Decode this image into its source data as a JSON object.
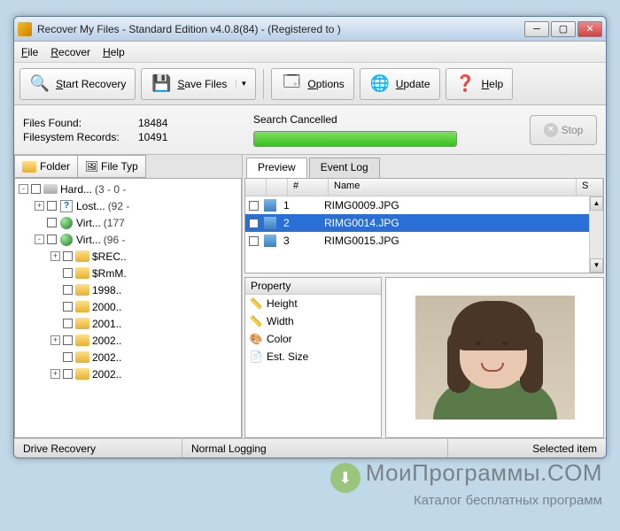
{
  "title": "Recover My Files - Standard Edition v4.0.8(84)  -  (Registered to )",
  "menu": {
    "file": "File",
    "recover": "Recover",
    "help": "Help"
  },
  "toolbar": {
    "start": "Start Recovery",
    "save": "Save Files",
    "options": "Options",
    "update": "Update",
    "help": "Help"
  },
  "status": {
    "found_lbl": "Files Found:",
    "found_val": "18484",
    "records_lbl": "Filesystem Records:",
    "records_val": "10491",
    "search_state": "Search Cancelled",
    "stop": "Stop"
  },
  "left_tabs": {
    "folder": "Folder",
    "filetype": "File Typ"
  },
  "tree": [
    {
      "indent": 0,
      "exp": "-",
      "icon": "drive",
      "label": "Hard...",
      "suffix": "(3 - 0 -"
    },
    {
      "indent": 1,
      "exp": "+",
      "icon": "q",
      "label": "Lost...",
      "suffix": "(92 -"
    },
    {
      "indent": 1,
      "exp": "",
      "icon": "globe",
      "label": "Virt...",
      "suffix": "(177"
    },
    {
      "indent": 1,
      "exp": "-",
      "icon": "globe",
      "label": "Virt...",
      "suffix": "(96 -"
    },
    {
      "indent": 2,
      "exp": "+",
      "icon": "folder",
      "label": "$REC..",
      "suffix": ""
    },
    {
      "indent": 2,
      "exp": "",
      "icon": "folder",
      "label": "$RmM.",
      "suffix": ""
    },
    {
      "indent": 2,
      "exp": "",
      "icon": "folder",
      "label": "1998..",
      "suffix": ""
    },
    {
      "indent": 2,
      "exp": "",
      "icon": "folder",
      "label": "2000..",
      "suffix": ""
    },
    {
      "indent": 2,
      "exp": "",
      "icon": "folder",
      "label": "2001..",
      "suffix": ""
    },
    {
      "indent": 2,
      "exp": "+",
      "icon": "folder",
      "label": "2002..",
      "suffix": ""
    },
    {
      "indent": 2,
      "exp": "",
      "icon": "folder",
      "label": "2002..",
      "suffix": ""
    },
    {
      "indent": 2,
      "exp": "+",
      "icon": "folder",
      "label": "2002..",
      "suffix": ""
    }
  ],
  "right_tabs": {
    "preview": "Preview",
    "eventlog": "Event Log"
  },
  "file_cols": {
    "num": "#",
    "name": "Name",
    "s": "S"
  },
  "files": [
    {
      "num": "1",
      "name": "RIMG0009.JPG",
      "sel": false
    },
    {
      "num": "2",
      "name": "RIMG0014.JPG",
      "sel": true
    },
    {
      "num": "3",
      "name": "RIMG0015.JPG",
      "sel": false
    }
  ],
  "props": {
    "header": "Property",
    "items": [
      "Height",
      "Width",
      "Color",
      "Est. Size"
    ]
  },
  "statusbar": {
    "left": "Drive Recovery",
    "mid": "Normal Logging",
    "right": "Selected item"
  },
  "watermark": {
    "line1": "МоиПрограммы.COM",
    "line2": "Каталог бесплатных программ"
  }
}
